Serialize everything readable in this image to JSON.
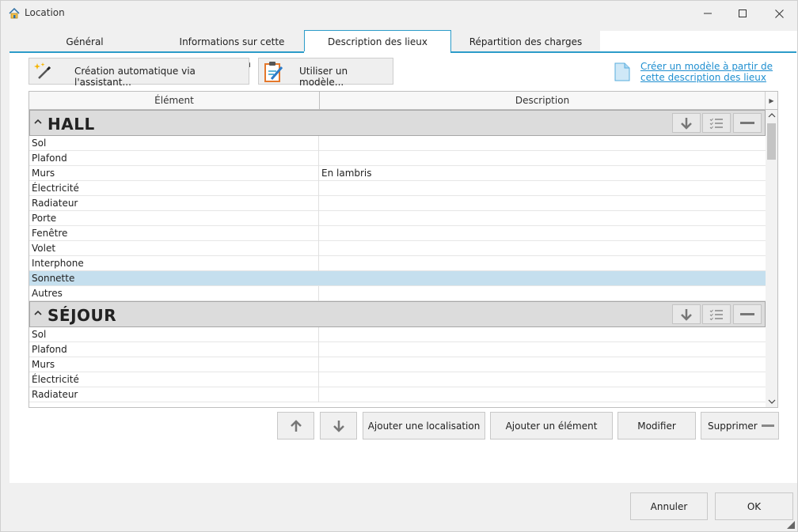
{
  "window": {
    "title": "Location"
  },
  "tabs": [
    {
      "label": "Général"
    },
    {
      "label": "Informations sur cette location"
    },
    {
      "label": "Description des lieux"
    },
    {
      "label": "Répartition des charges"
    }
  ],
  "active_tab": "Description des lieux",
  "toolbar": {
    "wizard_label": "Création automatique via l'assistant...",
    "template_label": "Utiliser un modèle...",
    "create_template_link": "Créer un modèle à partir de cette description des lieux"
  },
  "grid": {
    "columns": [
      "Élément",
      "Description"
    ],
    "groups": [
      {
        "title": "HALL",
        "rows": [
          {
            "element": "Sol",
            "description": ""
          },
          {
            "element": "Plafond",
            "description": ""
          },
          {
            "element": "Murs",
            "description": "En lambris"
          },
          {
            "element": "Électricité",
            "description": ""
          },
          {
            "element": "Radiateur",
            "description": ""
          },
          {
            "element": "Porte",
            "description": ""
          },
          {
            "element": "Fenêtre",
            "description": ""
          },
          {
            "element": "Volet",
            "description": ""
          },
          {
            "element": "Interphone",
            "description": ""
          },
          {
            "element": "Sonnette",
            "description": ""
          },
          {
            "element": "Autres",
            "description": ""
          }
        ]
      },
      {
        "title": "SÉJOUR",
        "rows": [
          {
            "element": "Sol",
            "description": ""
          },
          {
            "element": "Plafond",
            "description": ""
          },
          {
            "element": "Murs",
            "description": ""
          },
          {
            "element": "Électricité",
            "description": ""
          },
          {
            "element": "Radiateur",
            "description": ""
          }
        ]
      }
    ],
    "selected_row": "Sonnette"
  },
  "actions": {
    "add_location": "Ajouter une localisation",
    "add_element": "Ajouter un élément",
    "modify": "Modifier",
    "delete": "Supprimer"
  },
  "footer": {
    "cancel": "Annuler",
    "ok": "OK"
  },
  "colors": {
    "accent": "#2c9cc9",
    "link": "#1f8fd0",
    "selection": "#c5dfee",
    "group_header": "#dcdcdc"
  }
}
